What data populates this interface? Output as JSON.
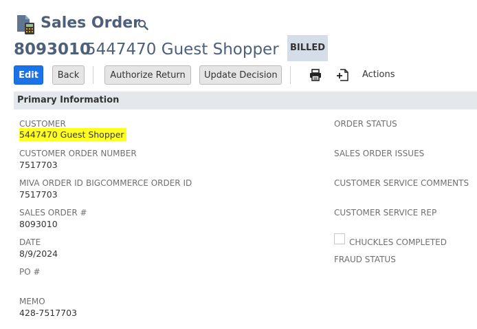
{
  "header": {
    "title": "Sales Order",
    "record_number": "8093010",
    "record_name": "5447470 Guest Shopper",
    "status": "BILLED"
  },
  "toolbar": {
    "edit_label": "Edit",
    "back_label": "Back",
    "authorize_return_label": "Authorize Return",
    "update_decision_label": "Update Decision",
    "actions_label": "Actions"
  },
  "section": {
    "title": "Primary Information"
  },
  "fields_left": {
    "customer": {
      "label": "CUSTOMER",
      "value": "5447470 Guest Shopper"
    },
    "customer_order_number": {
      "label": "CUSTOMER ORDER NUMBER",
      "value": "7517703"
    },
    "miva_order_id": {
      "label": "MIVA ORDER ID",
      "value": "7517703"
    },
    "bigcommerce_order_id": {
      "label": "BIGCOMMERCE ORDER ID",
      "value": ""
    },
    "sales_order_number": {
      "label": "SALES ORDER #",
      "value": "8093010"
    },
    "date": {
      "label": "DATE",
      "value": "8/9/2024"
    },
    "po_number": {
      "label": "PO #",
      "value": ""
    },
    "memo": {
      "label": "MEMO",
      "value": "428-7517703"
    }
  },
  "fields_right": {
    "order_status": {
      "label": "ORDER STATUS"
    },
    "sales_order_issues": {
      "label": "SALES ORDER ISSUES"
    },
    "customer_service_comments": {
      "label": "CUSTOMER SERVICE COMMENTS"
    },
    "customer_service_rep": {
      "label": "CUSTOMER SERVICE REP"
    },
    "chuckles_completed": {
      "label": "CHUCKLES COMPLETED",
      "checked": false
    },
    "fraud_status": {
      "label": "FRAUD STATUS"
    }
  },
  "colors": {
    "title": "#4d5f79",
    "primary_button": "#1a73e8",
    "highlight": "#ffff24",
    "section_header_bg": "#e4e7ec",
    "badge_bg": "#d5dde8"
  },
  "icons": [
    "sales-order-record-icon",
    "search-icon",
    "print-icon",
    "new-document-icon"
  ]
}
